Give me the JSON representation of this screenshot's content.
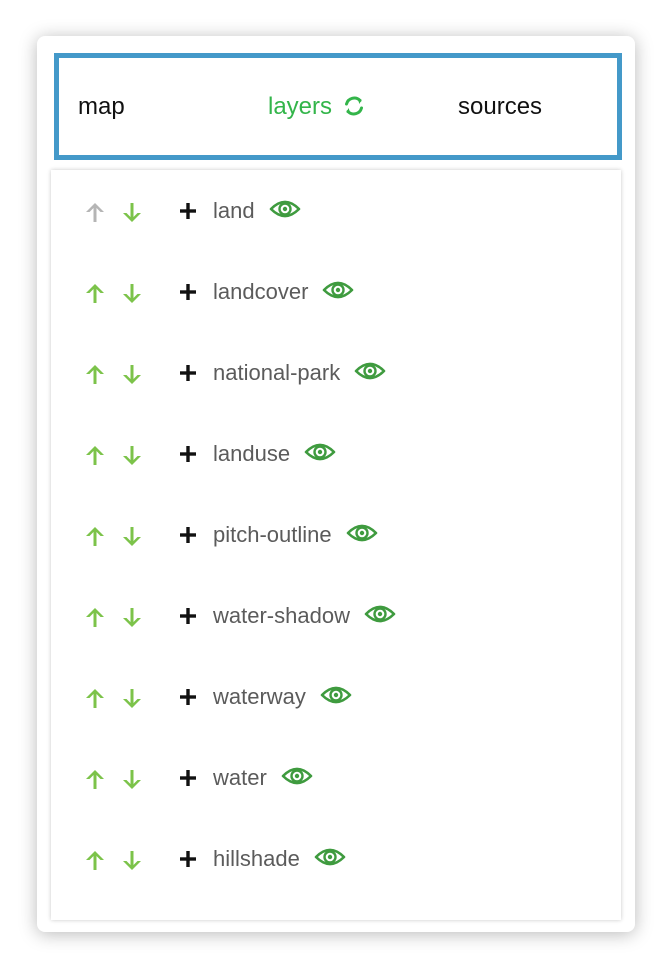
{
  "tabs": {
    "map": "map",
    "layers": "layers",
    "sources": "sources",
    "active": "layers",
    "refresh_icon": "refresh-icon"
  },
  "colors": {
    "accent": "#33b54a",
    "arrow_active": "#7cc34a",
    "arrow_disabled": "#b5b5b5",
    "eye": "#3f9b3f",
    "border": "#4499c9"
  },
  "layers": [
    {
      "name": "land",
      "up_enabled": false,
      "down_enabled": true
    },
    {
      "name": "landcover",
      "up_enabled": true,
      "down_enabled": true
    },
    {
      "name": "national-park",
      "up_enabled": true,
      "down_enabled": true
    },
    {
      "name": "landuse",
      "up_enabled": true,
      "down_enabled": true
    },
    {
      "name": "pitch-outline",
      "up_enabled": true,
      "down_enabled": true
    },
    {
      "name": "water-shadow",
      "up_enabled": true,
      "down_enabled": true
    },
    {
      "name": "waterway",
      "up_enabled": true,
      "down_enabled": true
    },
    {
      "name": "water",
      "up_enabled": true,
      "down_enabled": true
    },
    {
      "name": "hillshade",
      "up_enabled": true,
      "down_enabled": true
    }
  ]
}
